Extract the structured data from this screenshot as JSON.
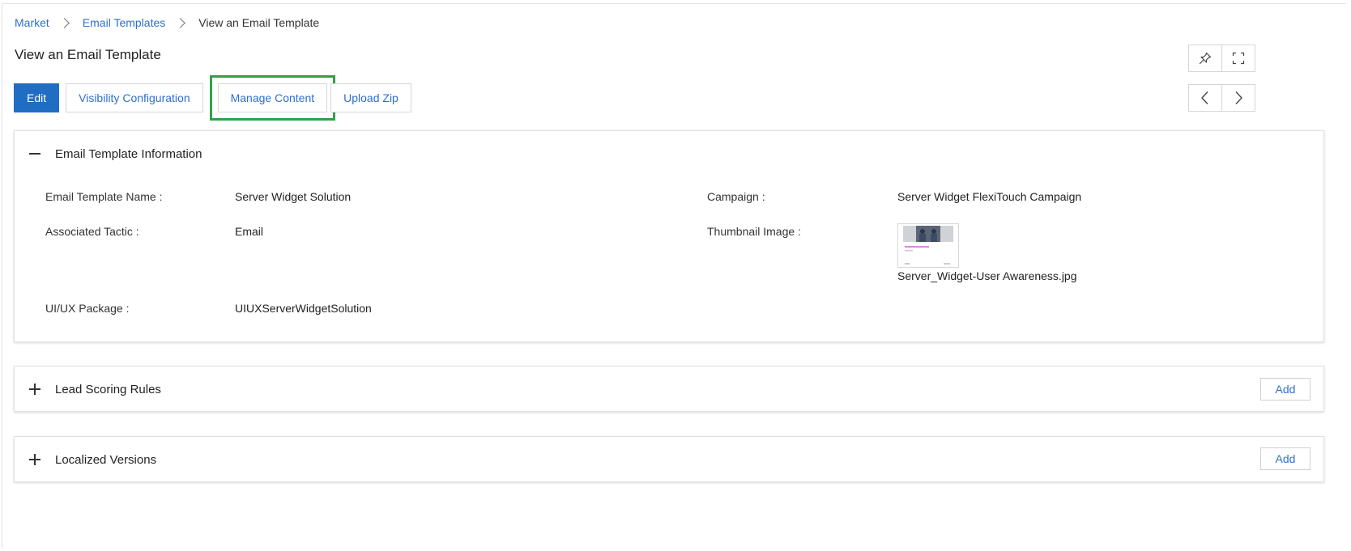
{
  "breadcrumb": {
    "items": [
      "Market",
      "Email Templates"
    ],
    "current": "View an Email Template"
  },
  "page_title": "View an Email Template",
  "toolbar": {
    "edit": "Edit",
    "visibility": "Visibility Configuration",
    "manage_content": "Manage Content",
    "upload_zip": "Upload Zip"
  },
  "icons": {
    "pin": "pin-icon",
    "fullscreen": "fullscreen-icon",
    "prev": "chevron-left-icon",
    "next": "chevron-right-icon"
  },
  "info_panel": {
    "title": "Email Template Information",
    "fields": {
      "name_label": "Email Template Name :",
      "name_value": "Server Widget Solution",
      "campaign_label": "Campaign :",
      "campaign_value": "Server Widget FlexiTouch Campaign",
      "tactic_label": "Associated Tactic :",
      "tactic_value": "Email",
      "thumbnail_label": "Thumbnail Image :",
      "thumbnail_file": "Server_Widget-User Awareness.jpg",
      "package_label": "UI/UX Package :",
      "package_value": "UIUXServerWidgetSolution"
    }
  },
  "lead_scoring": {
    "title": "Lead Scoring Rules",
    "add": "Add"
  },
  "localized": {
    "title": "Localized Versions",
    "add": "Add"
  },
  "colors": {
    "primary": "#1f6ec4",
    "link": "#2f6fd0",
    "highlight": "#2ea24a"
  }
}
